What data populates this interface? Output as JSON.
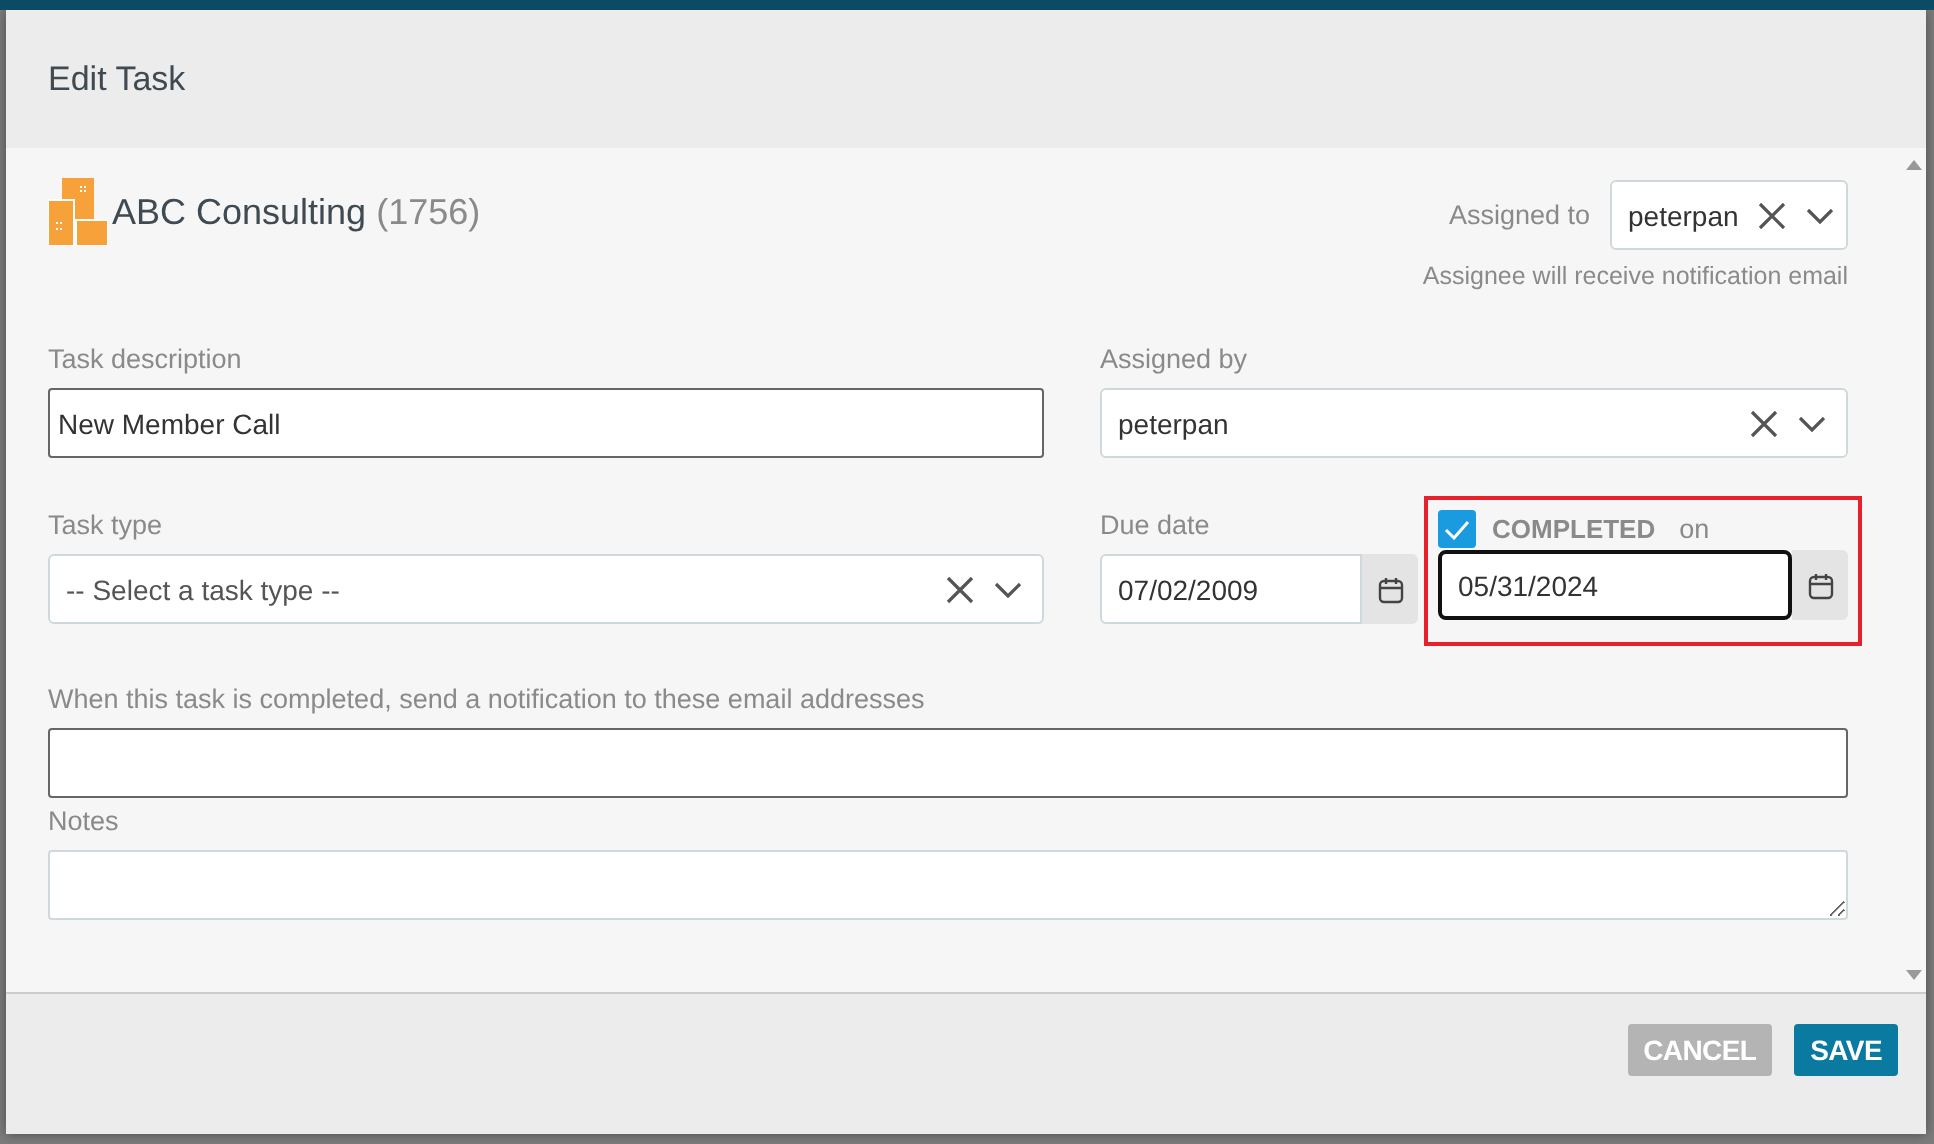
{
  "dialog": {
    "title": "Edit Task"
  },
  "company": {
    "name": "ABC Consulting",
    "count": "(1756)"
  },
  "assigned_to": {
    "label": "Assigned to",
    "value": "peterpan",
    "hint": "Assignee will receive notification email"
  },
  "task_description": {
    "label": "Task description",
    "value": "New Member Call"
  },
  "assigned_by": {
    "label": "Assigned by",
    "value": "peterpan"
  },
  "task_type": {
    "label": "Task type",
    "placeholder": "-- Select a task type --"
  },
  "due_date": {
    "label": "Due date",
    "value": "07/02/2009"
  },
  "completed": {
    "label": "COMPLETED",
    "suffix": "on",
    "checked": true,
    "value": "05/31/2024",
    "focused": true,
    "highlighted": true
  },
  "notify_emails": {
    "label": "When this task is completed, send a notification to these email addresses"
  },
  "notes": {
    "label": "Notes"
  },
  "buttons": [
    {
      "label": "CANCEL",
      "disabled": true
    },
    {
      "label": "SAVE",
      "disabled": false
    }
  ]
}
